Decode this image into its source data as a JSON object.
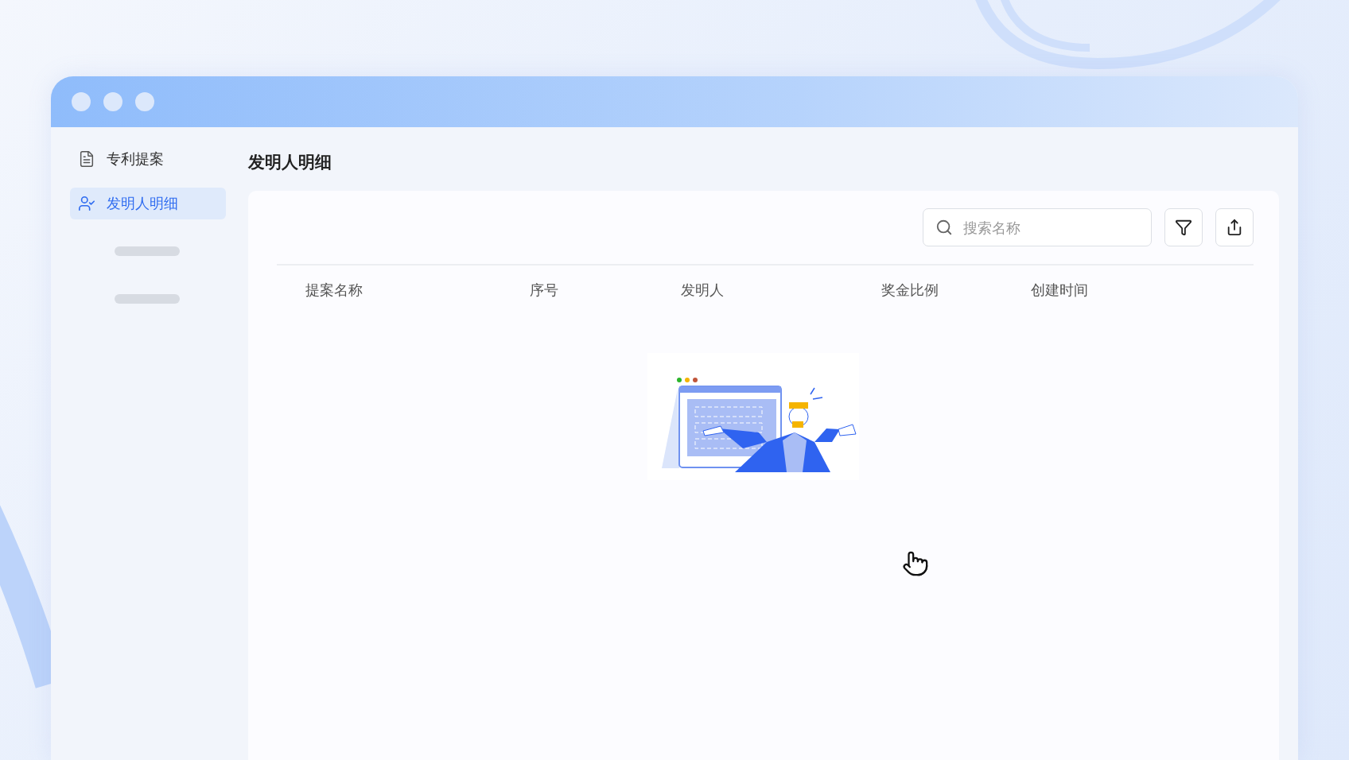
{
  "sidebar": {
    "items": [
      {
        "label": "专利提案",
        "kind": "document",
        "selected": false
      },
      {
        "label": "发明人明细",
        "kind": "person",
        "selected": true
      }
    ]
  },
  "page_title": "发明人明细",
  "search": {
    "placeholder": "搜索名称"
  },
  "table": {
    "columns": [
      "提案名称",
      "序号",
      "发明人",
      "奖金比例",
      "创建时间"
    ]
  }
}
